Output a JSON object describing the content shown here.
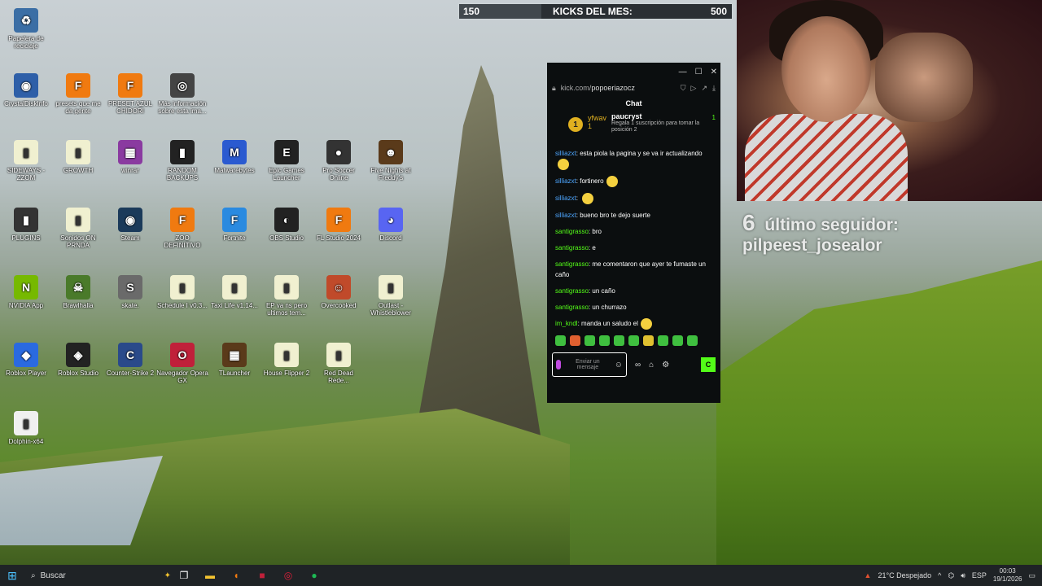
{
  "desktop": {
    "icons": [
      {
        "label": "Papelera de reciclaje",
        "glyph": "♻",
        "color": "#3b6ea5"
      },
      {
        "label": "CrystalDiskInfo",
        "glyph": "◉",
        "color": "#2e5fa8"
      },
      {
        "label": "presets que me da gente",
        "glyph": "F",
        "color": "#f07a10"
      },
      {
        "label": "PRESET AZUL CHIDORI",
        "glyph": "F",
        "color": "#f07a10"
      },
      {
        "label": "Más información sobre esta ima...",
        "glyph": "◎",
        "color": "#444"
      },
      {
        "label": "SIDEWAYS - ZZOM",
        "glyph": "▮",
        "color": "#f0f0d0"
      },
      {
        "label": "GROWTH",
        "glyph": "▮",
        "color": "#f0f0d0"
      },
      {
        "label": "winrar",
        "glyph": "▦",
        "color": "#8a3aa0"
      },
      {
        "label": "RANDOM BACKUPS",
        "glyph": "▮",
        "color": "#222"
      },
      {
        "label": "Malwarebytes",
        "glyph": "M",
        "color": "#2a5ad0"
      },
      {
        "label": "Epic Games Launcher",
        "glyph": "E",
        "color": "#222"
      },
      {
        "label": "Pro Soccer Online",
        "glyph": "●",
        "color": "#333"
      },
      {
        "label": "Five Nights at Freddy's",
        "glyph": "☻",
        "color": "#5a3a1a"
      },
      {
        "label": "PLUGINS",
        "glyph": "▮",
        "color": "#333"
      },
      {
        "label": "Sonidos ON PRNDA",
        "glyph": "▮",
        "color": "#f0f0d0"
      },
      {
        "label": "Steam",
        "glyph": "◉",
        "color": "#1b3a5a"
      },
      {
        "label": "ZOO DEFINITIVO",
        "glyph": "F",
        "color": "#f07a10"
      },
      {
        "label": "Fortnite",
        "glyph": "F",
        "color": "#2a8ae0"
      },
      {
        "label": "OBS Studio",
        "glyph": "◐",
        "color": "#222"
      },
      {
        "label": "FL Studio 2024",
        "glyph": "F",
        "color": "#f07a10"
      },
      {
        "label": "Discord",
        "glyph": "◕",
        "color": "#5865f2"
      },
      {
        "label": "NVIDIA App",
        "glyph": "N",
        "color": "#76b900"
      },
      {
        "label": "Brawlhalla",
        "glyph": "☠",
        "color": "#4a7a2a"
      },
      {
        "label": "skate.",
        "glyph": "S",
        "color": "#6a6a6a"
      },
      {
        "label": "Schedule I v0.3...",
        "glyph": "▮",
        "color": "#f0f0d0"
      },
      {
        "label": "Taxi Life v1.14...",
        "glyph": "▮",
        "color": "#f0f0d0"
      },
      {
        "label": "EP va ns pero ultimos tem...",
        "glyph": "▮",
        "color": "#f0f0d0"
      },
      {
        "label": "Overcooked",
        "glyph": "☺",
        "color": "#c04a2a"
      },
      {
        "label": "Outlast - Whistleblower",
        "glyph": "▮",
        "color": "#f0f0d0"
      },
      {
        "label": "Roblox Player",
        "glyph": "◆",
        "color": "#2a6ae0"
      },
      {
        "label": "Roblox Studio",
        "glyph": "◈",
        "color": "#222"
      },
      {
        "label": "Counter-Strike 2",
        "glyph": "C",
        "color": "#2a4a8a"
      },
      {
        "label": "Navegador Opera GX",
        "glyph": "O",
        "color": "#c0203a"
      },
      {
        "label": "TLauncher",
        "glyph": "▦",
        "color": "#5a3a1a"
      },
      {
        "label": "House Flipper 2",
        "glyph": "▮",
        "color": "#f0f0d0"
      },
      {
        "label": "Red Dead Rede...",
        "glyph": "▮",
        "color": "#f0f0d0"
      },
      {
        "label": "Dolphin-x64",
        "glyph": "▮",
        "color": "#f0f0f0"
      }
    ]
  },
  "kicks": {
    "current": "150",
    "label": "KICKS DEL MES:",
    "goal": "500",
    "progress": 0.3
  },
  "follower": {
    "number": "6",
    "text": "último seguidor: pilpeest_josealor"
  },
  "chat": {
    "url_prefix": "kick.com/",
    "url_path": "popoeriazocz",
    "title": "Chat",
    "pinned": {
      "gifter": "yfwav",
      "gifter_count": "1",
      "user": "paucryst",
      "user_count": "1",
      "desc": "Regala 1 suscripción para tomar la posición 2"
    },
    "messages": [
      {
        "user": "silliazxt",
        "text": "esta piola la pagina y se va ir actualizando",
        "emoji": true,
        "blue": true
      },
      {
        "user": "silliazxt",
        "text": "fortinero",
        "emoji": true,
        "blue": true
      },
      {
        "user": "silliazxt",
        "text": "",
        "emoji": true,
        "blue": true
      },
      {
        "user": "silliazxt",
        "text": "bueno bro te dejo suerte",
        "emoji": false,
        "blue": true
      },
      {
        "user": "santigrasso",
        "text": "bro",
        "emoji": false,
        "blue": false
      },
      {
        "user": "santigrasso",
        "text": "e",
        "emoji": false,
        "blue": false
      },
      {
        "user": "santigrasso",
        "text": "me comentaron que ayer te fumaste un caño",
        "emoji": false,
        "blue": false
      },
      {
        "user": "santigrasso",
        "text": "un caño",
        "emoji": false,
        "blue": false
      },
      {
        "user": "santigrasso",
        "text": "un churrazo",
        "emoji": false,
        "blue": false
      },
      {
        "user": "im_kndl",
        "text": "manda un saludo el",
        "emoji": true,
        "blue": false
      }
    ],
    "input_placeholder": "Enviar un mensaje",
    "send_label": "C",
    "infinity": "∞"
  },
  "taskbar": {
    "search_label": "Buscar",
    "weather": "21°C Despejado",
    "lang": "ESP",
    "time": "00:03",
    "date": "19/1/2026"
  }
}
